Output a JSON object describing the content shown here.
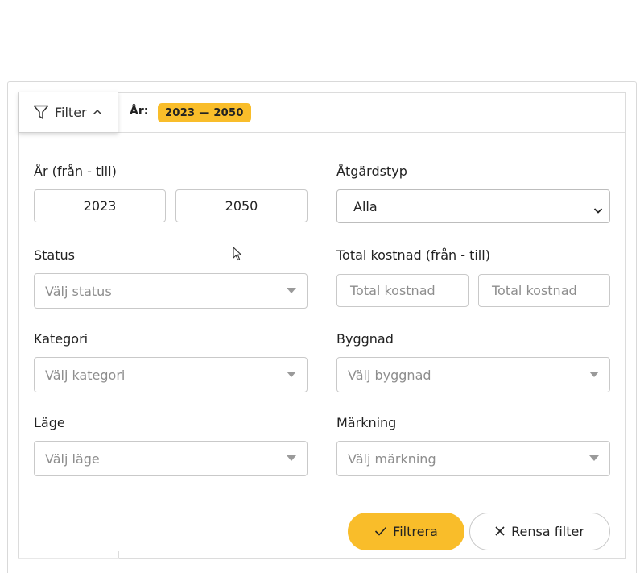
{
  "header": {
    "filter_label": "Filter",
    "year_label": "År:",
    "year_badge": "2023 — 2050"
  },
  "fields": {
    "year_range": {
      "label": "År (från - till)",
      "from": "2023",
      "to": "2050"
    },
    "measure_type": {
      "label": "Åtgärdstyp",
      "selected": "Alla"
    },
    "status": {
      "label": "Status",
      "placeholder": "Välj status"
    },
    "total_cost": {
      "label": "Total kostnad (från - till)",
      "from_placeholder": "Total kostnad",
      "to_placeholder": "Total kostnad"
    },
    "category": {
      "label": "Kategori",
      "placeholder": "Välj kategori"
    },
    "building": {
      "label": "Byggnad",
      "placeholder": "Välj byggnad"
    },
    "location": {
      "label": "Läge",
      "placeholder": "Välj läge"
    },
    "marking": {
      "label": "Märkning",
      "placeholder": "Välj märkning"
    }
  },
  "actions": {
    "apply_label": "Filtrera",
    "clear_label": "Rensa filter"
  },
  "colors": {
    "accent": "#f9bd2a",
    "border": "#c9c9c9",
    "placeholder": "#8e8e8e"
  },
  "icons": {
    "filter": "funnel-icon",
    "collapse": "chevron-up-icon",
    "select": "caret-down-icon",
    "dropdown": "chevron-down-icon",
    "apply": "check-icon",
    "clear": "close-icon"
  }
}
